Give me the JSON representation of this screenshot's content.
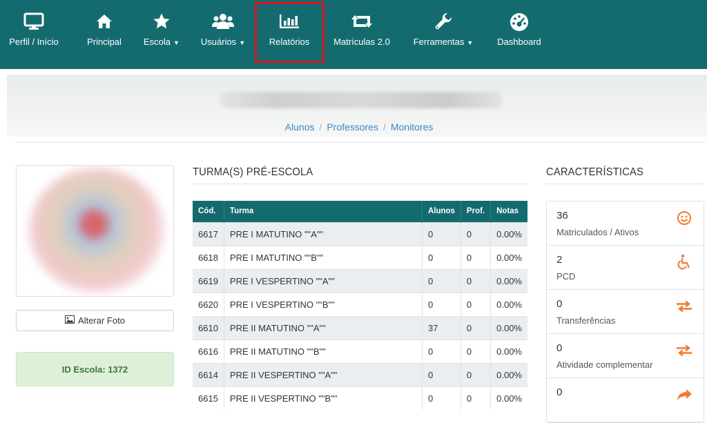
{
  "nav": {
    "items": [
      {
        "label": "Perfil / Início",
        "icon": "monitor-icon",
        "caret": false
      },
      {
        "label": "Principal",
        "icon": "home-icon",
        "caret": false
      },
      {
        "label": "Escola",
        "icon": "star-icon",
        "caret": true
      },
      {
        "label": "Usuários",
        "icon": "users-icon",
        "caret": true
      },
      {
        "label": "Relatórios",
        "icon": "bar-chart-icon",
        "caret": false
      },
      {
        "label": "Matrículas 2.0",
        "icon": "retweet-icon",
        "caret": false
      },
      {
        "label": "Ferramentas",
        "icon": "wrench-icon",
        "caret": true
      },
      {
        "label": "Dashboard",
        "icon": "dashboard-icon",
        "caret": false
      }
    ],
    "highlighted": "Relatórios"
  },
  "breadcrumb": {
    "links": [
      "Alunos",
      "Professores",
      "Monitores"
    ],
    "separator": "/"
  },
  "left": {
    "change_photo_label": "Alterar Foto",
    "school_id": "ID Escola: 1372"
  },
  "turmas": {
    "title": "TURMA(S) PRÉ-ESCOLA",
    "headers": [
      "Cód.",
      "Turma",
      "Alunos",
      "Prof.",
      "Notas"
    ],
    "rows": [
      {
        "cod": "6617",
        "turma": "PRE I MATUTINO \"\"A\"\"",
        "alunos": "0",
        "prof": "0",
        "notas": "0.00%"
      },
      {
        "cod": "6618",
        "turma": "PRE I MATUTINO \"\"B\"\"",
        "alunos": "0",
        "prof": "0",
        "notas": "0.00%"
      },
      {
        "cod": "6619",
        "turma": "PRE I VESPERTINO \"\"A\"\"",
        "alunos": "0",
        "prof": "0",
        "notas": "0.00%"
      },
      {
        "cod": "6620",
        "turma": "PRE I VESPERTINO \"\"B\"\"",
        "alunos": "0",
        "prof": "0",
        "notas": "0.00%"
      },
      {
        "cod": "6610",
        "turma": "PRE II MATUTINO \"\"A\"\"",
        "alunos": "37",
        "prof": "0",
        "notas": "0.00%"
      },
      {
        "cod": "6616",
        "turma": "PRE II MATUTINO \"\"B\"\"",
        "alunos": "0",
        "prof": "0",
        "notas": "0.00%"
      },
      {
        "cod": "6614",
        "turma": "PRE II VESPERTINO \"\"A\"\"",
        "alunos": "0",
        "prof": "0",
        "notas": "0.00%"
      },
      {
        "cod": "6615",
        "turma": "PRE II VESPERTINO \"\"B\"\"",
        "alunos": "0",
        "prof": "0",
        "notas": "0.00%"
      }
    ]
  },
  "caracteristicas": {
    "title": "CARACTERÍSTICAS",
    "cards": [
      {
        "value": "36",
        "label": "Matriculados / Ativos",
        "icon": "smile-icon"
      },
      {
        "value": "2",
        "label": "PCD",
        "icon": "wheelchair-icon"
      },
      {
        "value": "0",
        "label": "Transferências",
        "icon": "exchange-icon"
      },
      {
        "value": "0",
        "label": "Atividade complementar",
        "icon": "exchange-icon"
      },
      {
        "value": "0",
        "label": "",
        "icon": "share-icon"
      }
    ]
  },
  "colors": {
    "nav_bg": "#146b6f",
    "link": "#3a87c4",
    "accent_orange": "#f07a2a",
    "highlight_red": "#e0151d",
    "success_bg": "#dff0d8"
  }
}
